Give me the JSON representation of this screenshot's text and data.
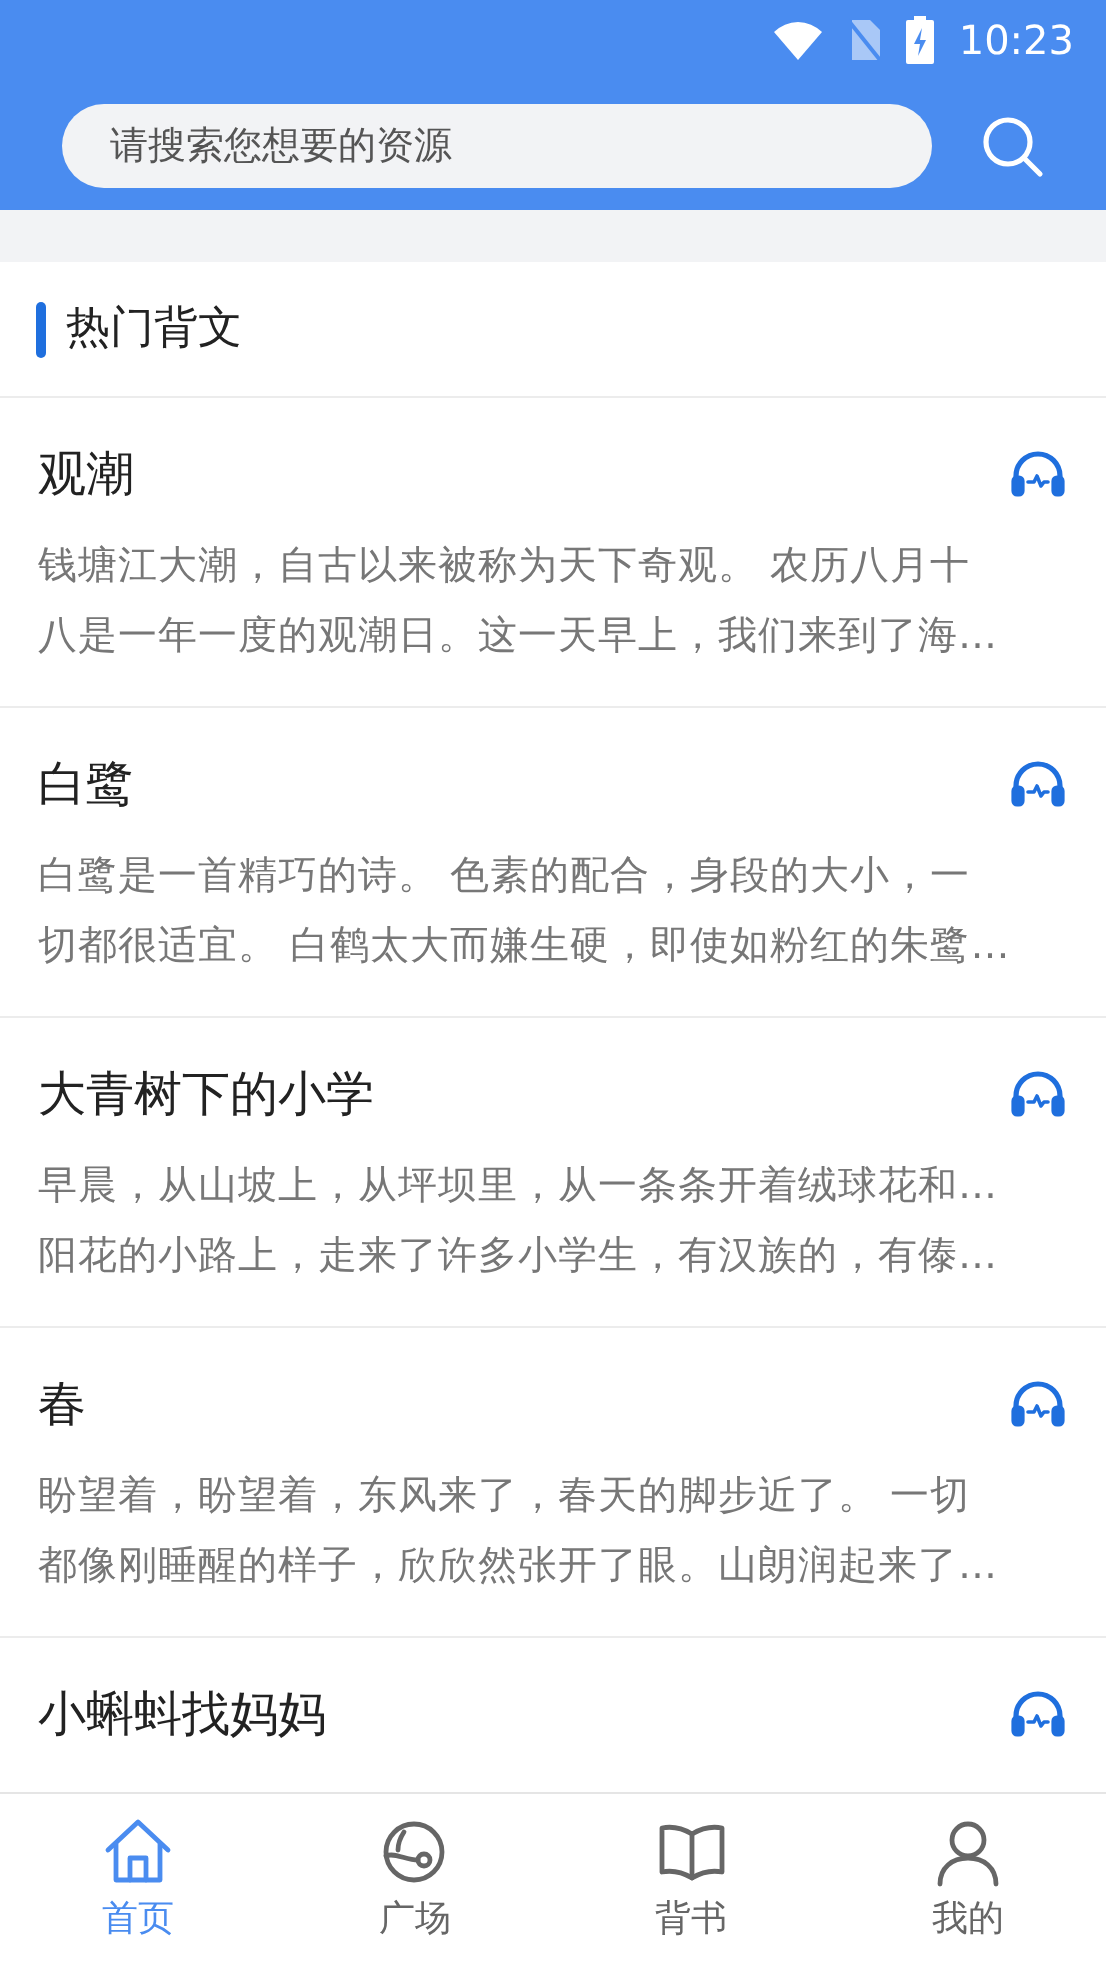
{
  "status_bar": {
    "time": "10:23"
  },
  "search": {
    "placeholder": "请搜索您想要的资源"
  },
  "section": {
    "title": "热门背文"
  },
  "items": [
    {
      "title": "观潮",
      "lines": [
        "钱塘江大潮，自古以来被称为天下奇观。 农历八月十",
        "八是一年一度的观潮日。这一天早上，我们来到了海…"
      ]
    },
    {
      "title": "白鹭",
      "lines": [
        "白鹭是一首精巧的诗。 色素的配合，身段的大小，一",
        "切都很适宜。 白鹤太大而嫌生硬，即使如粉红的朱鹭…"
      ]
    },
    {
      "title": "大青树下的小学",
      "lines": [
        "早晨，从山坡上，从坪坝里，从一条条开着绒球花和…",
        "阳花的小路上，走来了许多小学生，有汉族的，有傣…"
      ]
    },
    {
      "title": "春",
      "lines": [
        "盼望着，盼望着，东风来了，春天的脚步近了。 一切",
        "都像刚睡醒的样子，欣欣然张开了眼。山朗润起来了…"
      ]
    },
    {
      "title": "小蝌蚪找妈妈"
    }
  ],
  "tabs": [
    {
      "label": "首页",
      "kind": "home",
      "selected": true
    },
    {
      "label": "广场",
      "kind": "planet",
      "selected": false
    },
    {
      "label": "背书",
      "kind": "book",
      "selected": false
    },
    {
      "label": "我的",
      "kind": "person",
      "selected": false
    }
  ]
}
